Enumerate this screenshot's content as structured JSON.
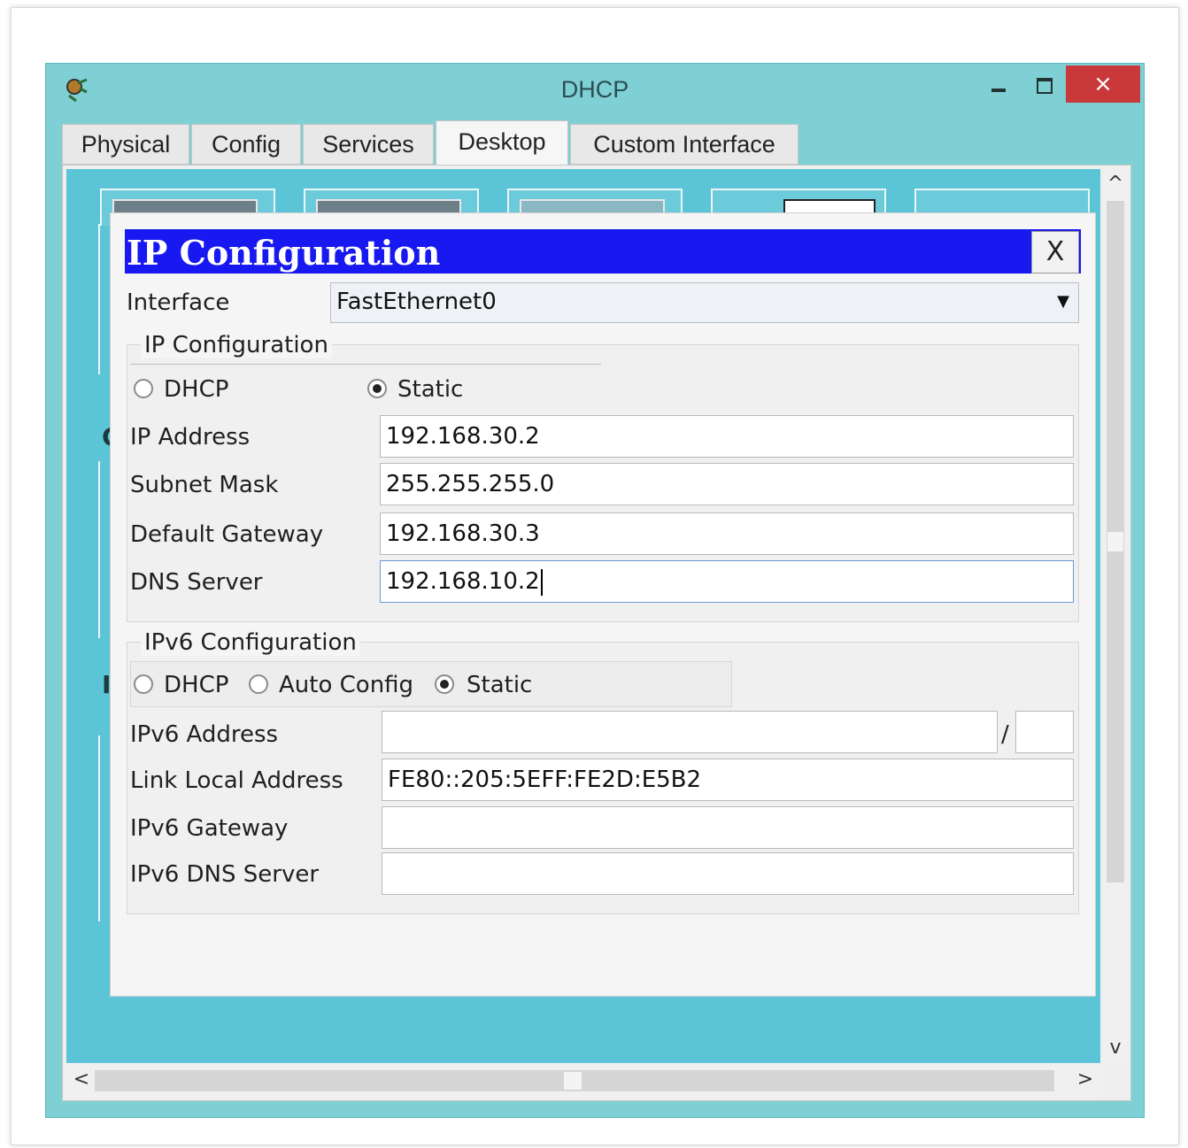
{
  "window": {
    "title": "DHCP",
    "close_symbol": "×"
  },
  "tabs": [
    {
      "label": "Physical"
    },
    {
      "label": "Config"
    },
    {
      "label": "Services"
    },
    {
      "label": "Desktop"
    },
    {
      "label": "Custom Interface"
    }
  ],
  "active_tab": "Desktop",
  "scroll": {
    "up": "^",
    "down": "v",
    "left": "<",
    "right": ">"
  },
  "dialog": {
    "title": "IP Configuration",
    "close_label": "X",
    "interface_label": "Interface",
    "interface_value": "FastEthernet0",
    "ipv4": {
      "section_label": "IP Configuration",
      "mode_dhcp": "DHCP",
      "mode_static": "Static",
      "selected_mode": "Static",
      "ip_address_label": "IP Address",
      "ip_address": "192.168.30.2",
      "subnet_mask_label": "Subnet Mask",
      "subnet_mask": "255.255.255.0",
      "default_gateway_label": "Default Gateway",
      "default_gateway": "192.168.30.3",
      "dns_server_label": "DNS Server",
      "dns_server": "192.168.10.2"
    },
    "ipv6": {
      "section_label": "IPv6 Configuration",
      "mode_dhcp": "DHCP",
      "mode_auto": "Auto Config",
      "mode_static": "Static",
      "selected_mode": "Static",
      "address_label": "IPv6 Address",
      "address": "",
      "prefix_separator": "/",
      "prefix": "",
      "link_local_label": "Link Local Address",
      "link_local": "FE80::205:5EFF:FE2D:E5B2",
      "gateway_label": "IPv6 Gateway",
      "gateway": "",
      "dns_server_label": "IPv6 DNS Server",
      "dns_server": ""
    }
  },
  "background_fragments": [
    "C",
    "I"
  ],
  "colors": {
    "window_frame": "#7fd0d4",
    "desktop": "#5bc4d6",
    "dialog_title": "#1818f0",
    "close_button": "#c9393a"
  }
}
